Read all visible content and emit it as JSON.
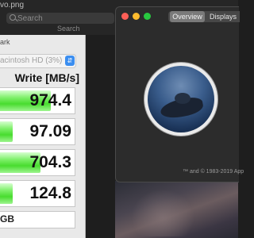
{
  "background_window": {
    "title": "vo.png",
    "search_placeholder": "Search",
    "search_label": "Search"
  },
  "disk_speed_test": {
    "title": "ark",
    "disk_selector": "acintosh HD (3%)",
    "write_header": "Write [MB/s]",
    "speeds": [
      {
        "value": "974.4",
        "fill_percent": 68
      },
      {
        "value": "97.09",
        "fill_percent": 17
      },
      {
        "value": "704.3",
        "fill_percent": 54
      },
      {
        "value": "124.8",
        "fill_percent": 17
      }
    ],
    "size": "GB"
  },
  "about_this_mac": {
    "tabs": [
      "Overview",
      "Displays"
    ],
    "active_tab": "Overview",
    "copyright": "™ and © 1983-2019 App"
  }
}
